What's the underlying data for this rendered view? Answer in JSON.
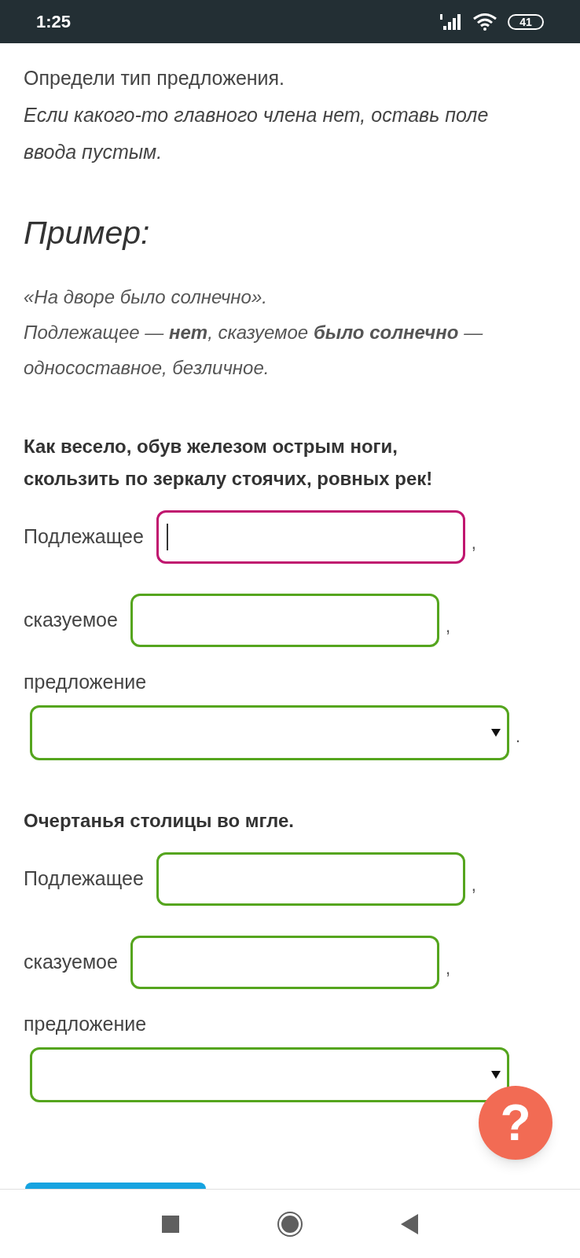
{
  "status_bar": {
    "time": "1:25",
    "battery": "41"
  },
  "instructions": [
    {
      "text": "Определи тип предложения.",
      "kind": "rule"
    },
    {
      "text": "Если какого-то главного члена нет, оставь поле ввода пустым.",
      "kind": "hint"
    }
  ],
  "example": {
    "heading": "Пример:",
    "lines": [
      "«На дворе было солнечно».",
      "Подлежащее — **нет**, сказуемое **было солнечно** — односоставное, безличное."
    ]
  },
  "tasks": [
    {
      "sentence": "Как весело, обув железом острым ноги, скользить по зеркалу стоячих, ровных рек!",
      "fields": [
        {
          "kind": "input",
          "label": "Подлежащее",
          "focused": true,
          "after": ","
        },
        {
          "kind": "input",
          "label": "сказуемое",
          "focused": false,
          "after": ","
        },
        {
          "kind": "select",
          "label": "предложение",
          "focused": false,
          "after": "."
        }
      ]
    },
    {
      "sentence": "Очертанья столицы во мгле.",
      "fields": [
        {
          "kind": "input",
          "label": "Подлежащее",
          "focused": false,
          "after": ","
        },
        {
          "kind": "input",
          "label": "сказуемое",
          "focused": false,
          "after": ","
        },
        {
          "kind": "select",
          "label": "предложение",
          "focused": false
        }
      ]
    }
  ],
  "help_button": {
    "label": "?"
  }
}
